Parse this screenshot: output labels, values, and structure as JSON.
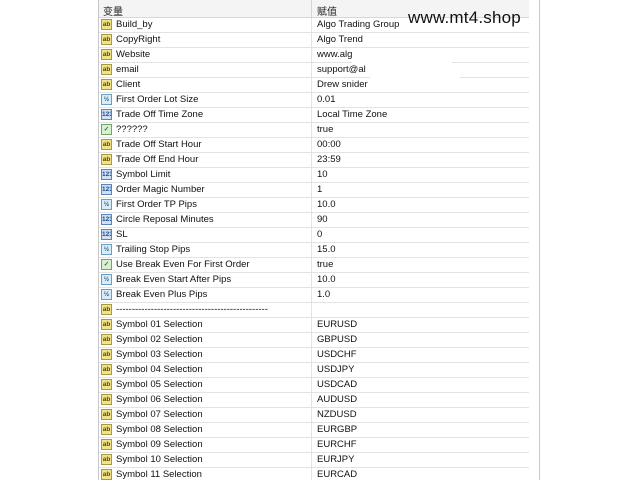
{
  "header": {
    "col1": "变量",
    "col2": "赋值"
  },
  "watermark": "www.mt4.shop",
  "rows": [
    {
      "icon": "ab",
      "name": "Build_by",
      "value": "Algo Trading Group"
    },
    {
      "icon": "ab",
      "name": "CopyRight",
      "value": "Algo Trend"
    },
    {
      "icon": "ab",
      "name": "Website",
      "value": "www.alg"
    },
    {
      "icon": "ab",
      "name": "email",
      "value": "support@al"
    },
    {
      "icon": "ab",
      "name": "Client",
      "value": "Drew snider"
    },
    {
      "icon": "dbl",
      "name": "First Order Lot Size",
      "value": "0.01"
    },
    {
      "icon": "tz",
      "name": "Trade Off Time Zone",
      "value": "Local Time Zone"
    },
    {
      "icon": "bool",
      "name": "??????",
      "value": "true"
    },
    {
      "icon": "ab",
      "name": "Trade Off Start Hour",
      "value": "00:00"
    },
    {
      "icon": "ab",
      "name": "Trade Off End Hour",
      "value": "23:59"
    },
    {
      "icon": "int",
      "name": "Symbol Limit",
      "value": "10"
    },
    {
      "icon": "int",
      "name": "Order Magic Number",
      "value": "1"
    },
    {
      "icon": "dbl",
      "name": "First Order TP Pips",
      "value": "10.0"
    },
    {
      "icon": "int",
      "name": "Circle Reposal Minutes",
      "value": "90"
    },
    {
      "icon": "int",
      "name": "SL",
      "value": "0"
    },
    {
      "icon": "dbl",
      "name": "Trailing Stop Pips",
      "value": "15.0"
    },
    {
      "icon": "bool",
      "name": "Use Break Even For First Order",
      "value": "true"
    },
    {
      "icon": "dbl",
      "name": "Break Even Start After Pips",
      "value": "10.0"
    },
    {
      "icon": "dbl",
      "name": "Break Even Plus Pips",
      "value": "1.0"
    },
    {
      "icon": "ab",
      "name": "------------------------------------------------",
      "value": ""
    },
    {
      "icon": "ab",
      "name": "Symbol 01 Selection",
      "value": "EURUSD"
    },
    {
      "icon": "ab",
      "name": "Symbol 02 Selection",
      "value": "GBPUSD"
    },
    {
      "icon": "ab",
      "name": "Symbol 03 Selection",
      "value": "USDCHF"
    },
    {
      "icon": "ab",
      "name": "Symbol 04 Selection",
      "value": "USDJPY"
    },
    {
      "icon": "ab",
      "name": "Symbol 05 Selection",
      "value": "USDCAD"
    },
    {
      "icon": "ab",
      "name": "Symbol 06 Selection",
      "value": "AUDUSD"
    },
    {
      "icon": "ab",
      "name": "Symbol 07 Selection",
      "value": "NZDUSD"
    },
    {
      "icon": "ab",
      "name": "Symbol 08 Selection",
      "value": "EURGBP"
    },
    {
      "icon": "ab",
      "name": "Symbol 09 Selection",
      "value": "EURCHF"
    },
    {
      "icon": "ab",
      "name": "Symbol 10 Selection",
      "value": "EURJPY"
    },
    {
      "icon": "ab",
      "name": "Symbol 11 Selection",
      "value": "EURCAD"
    }
  ],
  "icon_glyphs": {
    "ab": "ab",
    "dbl": "½",
    "int": "123",
    "bool": "✓",
    "tz": "123"
  }
}
